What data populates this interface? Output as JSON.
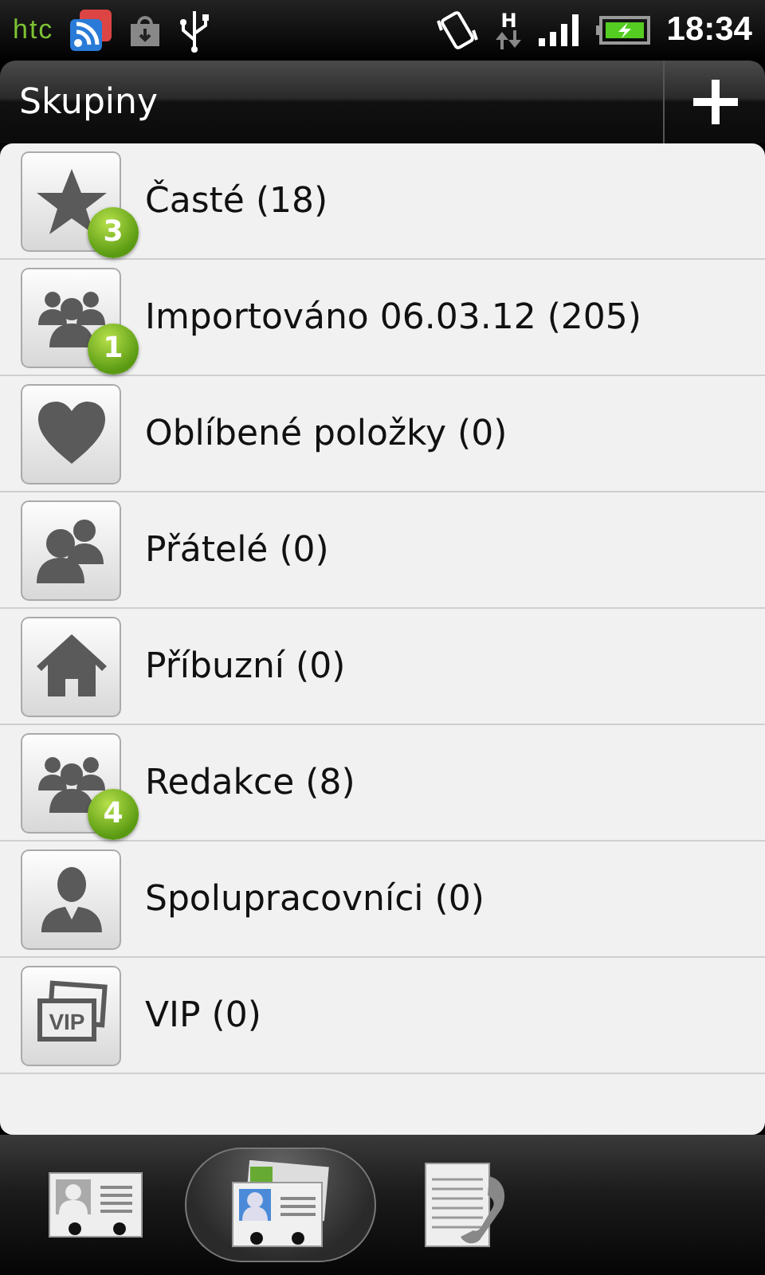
{
  "status_bar": {
    "carrier_logo": "htc",
    "network_type": "H",
    "time": "18:34"
  },
  "header": {
    "title": "Skupiny"
  },
  "groups": [
    {
      "kind": "star",
      "name": "Časté (18)",
      "badge": "3"
    },
    {
      "kind": "people",
      "name": "Importováno 06.03.12 (205)",
      "badge": "1"
    },
    {
      "kind": "heart",
      "name": "Oblíbené položky (0)"
    },
    {
      "kind": "friends",
      "name": "Přátelé (0)"
    },
    {
      "kind": "home",
      "name": "Příbuzní (0)"
    },
    {
      "kind": "people",
      "name": "Redakce (8)",
      "badge": "4"
    },
    {
      "kind": "person",
      "name": "Spolupracovníci (0)"
    },
    {
      "kind": "vip",
      "name": "VIP (0)",
      "icon_label": "VIP"
    }
  ],
  "bottom_tabs": [
    {
      "kind": "contact",
      "selected": false
    },
    {
      "kind": "groups",
      "selected": true
    },
    {
      "kind": "call_log",
      "selected": false
    }
  ]
}
